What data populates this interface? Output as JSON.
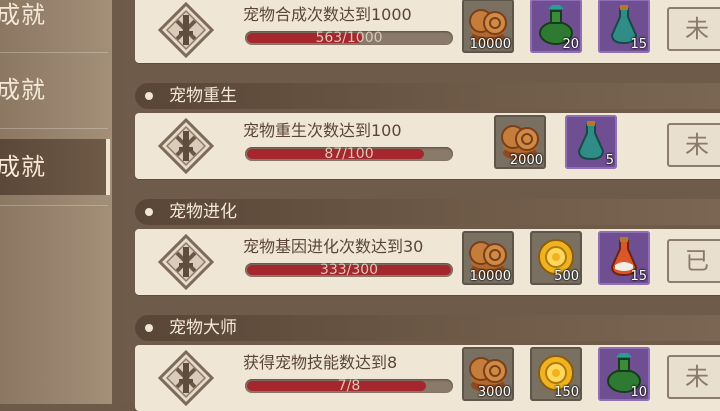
{
  "sidebar": {
    "tabs": [
      {
        "label": "成就"
      },
      {
        "label": "成就"
      },
      {
        "label": "成就"
      }
    ],
    "active_index": 2
  },
  "sections": [
    {
      "title": "",
      "tasks": [
        {
          "text": "宠物合成次数达到1000",
          "progress_text": "563/1000",
          "progress": 0.563,
          "rewards": [
            {
              "icon": "coins-icon",
              "qty": "10000",
              "rarity": "common"
            },
            {
              "icon": "green-potion-icon",
              "qty": "20",
              "rarity": "rare"
            },
            {
              "icon": "teal-potion-icon",
              "qty": "15",
              "rarity": "rare"
            }
          ],
          "button": "未"
        }
      ]
    },
    {
      "title": "宠物重生",
      "tasks": [
        {
          "text": "宠物重生次数达到100",
          "progress_text": "87/100",
          "progress": 0.87,
          "rewards": [
            {
              "icon": "coins-icon",
              "qty": "2000",
              "rarity": "common"
            },
            {
              "icon": "teal-potion-icon",
              "qty": "5",
              "rarity": "rare"
            }
          ],
          "button": "未"
        }
      ]
    },
    {
      "title": "宠物进化",
      "tasks": [
        {
          "text": "宠物基因进化次数达到30",
          "progress_text": "333/300",
          "progress": 1.0,
          "rewards": [
            {
              "icon": "coins-icon",
              "qty": "10000",
              "rarity": "common"
            },
            {
              "icon": "gold-coin-icon",
              "qty": "500",
              "rarity": "common"
            },
            {
              "icon": "orange-potion-icon",
              "qty": "15",
              "rarity": "rare"
            }
          ],
          "button": "已"
        }
      ]
    },
    {
      "title": "宠物大师",
      "tasks": [
        {
          "text": "获得宠物技能数达到8",
          "progress_text": "7/8",
          "progress": 0.875,
          "rewards": [
            {
              "icon": "coins-icon",
              "qty": "3000",
              "rarity": "common"
            },
            {
              "icon": "gold-coin-icon",
              "qty": "150",
              "rarity": "common"
            },
            {
              "icon": "green-potion-icon",
              "qty": "10",
              "rarity": "rare"
            }
          ],
          "button": "未"
        }
      ]
    }
  ],
  "colors": {
    "progress_fill": "#a5262c",
    "card_bg": "#efe6d6",
    "panel_bg": "#6e5b4a"
  }
}
